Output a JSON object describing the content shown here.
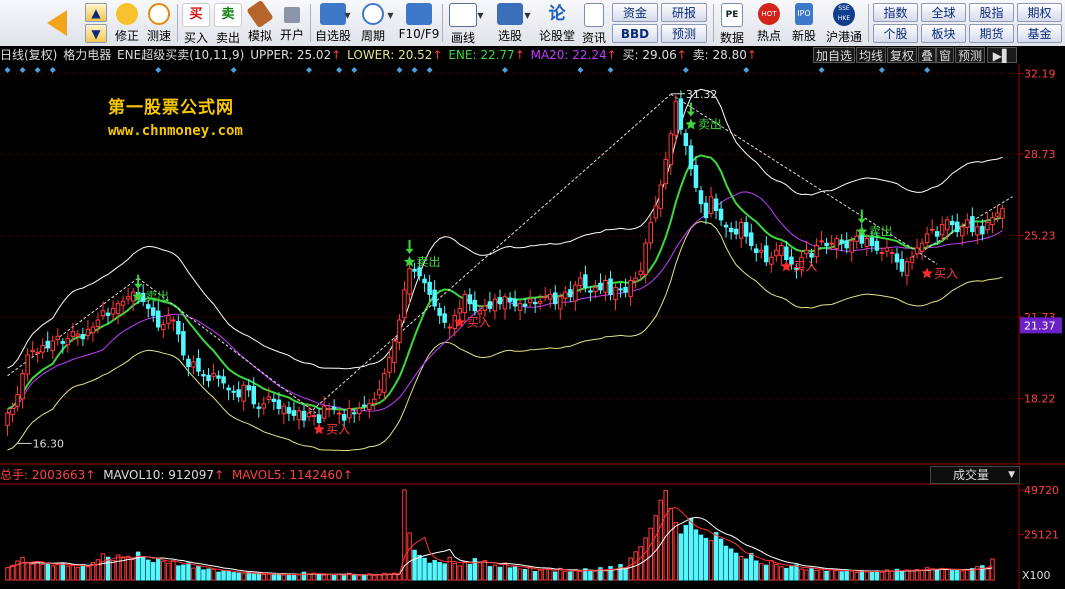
{
  "toolbar": {
    "nav": [
      {
        "label": "修正",
        "icon": "fix-icon"
      },
      {
        "label": "测速",
        "icon": "speed-clock-icon"
      }
    ],
    "trade": [
      {
        "label": "买入",
        "glyph": "买",
        "color": "#d01010"
      },
      {
        "label": "卖出",
        "glyph": "卖",
        "color": "#108010"
      },
      {
        "label": "模拟",
        "icon": "gavel-icon"
      },
      {
        "label": "开户",
        "icon": "lock-icon"
      }
    ],
    "tools": [
      {
        "label": "自选股",
        "icon": "watchlist-icon"
      },
      {
        "label": "周期",
        "icon": "period-icon"
      },
      {
        "label": "F10/F9",
        "icon": "f10-icon"
      },
      {
        "label": "画线",
        "icon": "draw-line-icon"
      },
      {
        "label": "选股",
        "icon": "stock-screen-icon"
      },
      {
        "label": "论股堂",
        "glyph": "论",
        "icon": "forum-icon"
      },
      {
        "label": "资讯",
        "icon": "news-icon"
      }
    ],
    "grid_left": {
      "top": [
        "资金",
        "研报"
      ],
      "bottom": [
        "BBD",
        "预测"
      ]
    },
    "data_buttons": [
      {
        "label": "数据",
        "badge": "PE",
        "icon": "data-pe-icon"
      },
      {
        "label": "热点",
        "badge": "HOT",
        "icon": "hot-icon"
      },
      {
        "label": "新股",
        "badge": "IPO",
        "icon": "ipo-icon"
      },
      {
        "label": "沪港通",
        "badge": "SSE HKE",
        "icon": "hk-connect-icon"
      }
    ],
    "grid_right": {
      "top": [
        "指数",
        "全球",
        "股指",
        "期权"
      ],
      "bottom": [
        "个股",
        "板块",
        "期货",
        "基金"
      ]
    }
  },
  "info_bar": {
    "period": "日线(复权)",
    "stock": "格力电器",
    "indicator": "ENE超级买卖(10,11,9)",
    "upper": "UPPER: 25.02",
    "lower": "LOWER: 20.52",
    "ene": "ENE: 22.77",
    "ma20": "MA20: 22.24",
    "buy": "买: 29.06",
    "sell": "卖: 28.80",
    "arrow": "↑",
    "buttons": [
      "加自选",
      "均线",
      "复权",
      "叠",
      "窗",
      "预测"
    ]
  },
  "watermark": {
    "title": "第一股票公式网",
    "url": "www.chnmoney.com"
  },
  "price_axis": {
    "ticks": [
      "32.19",
      "28.73",
      "25.23",
      "21.73",
      "18.22"
    ],
    "current": "21.37"
  },
  "volume_axis": {
    "ticks": [
      "49720",
      "25121"
    ],
    "unit": "X100"
  },
  "volume_header": {
    "total": "总手: 2003663",
    "mavol10": "MAVOL10: 912097",
    "mavol5": "MAVOL5: 1142460",
    "arrow": "↑",
    "selector": "成交量"
  },
  "colors": {
    "up": "#ff3b3b",
    "down": "#54f7ff",
    "ene": "#3ed63e",
    "ma20": "#c43cff",
    "upper": "#ffffff",
    "lower": "#e3e38a",
    "axis": "#a00000",
    "label": "#ff4040"
  },
  "chart_data": {
    "type": "candlestick",
    "y_range": [
      15.5,
      32.6
    ],
    "price_ticks": [
      32.19,
      28.73,
      25.23,
      21.73,
      18.22
    ],
    "annotations": [
      {
        "text": "16.30",
        "bar": 2,
        "price": 16.3
      },
      {
        "text": "31.32",
        "bar": 132,
        "price": 31.32
      }
    ],
    "signals": [
      {
        "type": "sell",
        "label": "卖出",
        "bar": 26,
        "price": 22.6
      },
      {
        "type": "buy",
        "label": "买入",
        "bar": 62,
        "price": 16.9
      },
      {
        "type": "sell",
        "label": "卖出",
        "bar": 80,
        "price": 24.1
      },
      {
        "type": "buy",
        "label": "买入",
        "bar": 90,
        "price": 21.5
      },
      {
        "type": "sell",
        "label": "卖出",
        "bar": 136,
        "price": 30.0
      },
      {
        "type": "buy",
        "label": "买入",
        "bar": 155,
        "price": 23.9
      },
      {
        "type": "sell",
        "label": "卖出",
        "bar": 170,
        "price": 25.4
      },
      {
        "type": "buy",
        "label": "买入",
        "bar": 183,
        "price": 23.6
      }
    ],
    "close": [
      17.6,
      17.8,
      18.4,
      19.3,
      20.1,
      20.3,
      20.2,
      20.5,
      20.4,
      20.7,
      20.9,
      20.6,
      20.8,
      21.1,
      21.0,
      20.8,
      21.2,
      21.3,
      21.6,
      22.0,
      21.8,
      22.1,
      22.3,
      22.4,
      22.6,
      22.8,
      22.6,
      22.4,
      22.1,
      21.8,
      21.3,
      21.4,
      21.8,
      21.6,
      21.0,
      20.1,
      19.6,
      19.8,
      19.4,
      19.2,
      19.0,
      19.3,
      19.1,
      18.9,
      18.6,
      18.5,
      18.3,
      18.8,
      18.6,
      18.0,
      17.8,
      18.0,
      18.3,
      18.1,
      17.8,
      17.9,
      17.6,
      17.5,
      17.7,
      17.3,
      17.6,
      17.5,
      17.2,
      17.9,
      17.8,
      17.8,
      17.6,
      17.3,
      17.8,
      17.6,
      17.8,
      17.9,
      18.0,
      18.2,
      18.6,
      19.3,
      20.0,
      20.7,
      21.6,
      22.9,
      23.8,
      23.7,
      23.5,
      23.2,
      22.7,
      22.2,
      21.8,
      21.5,
      21.3,
      21.8,
      22.1,
      22.7,
      22.3,
      22.0,
      22.0,
      22.2,
      22.1,
      22.5,
      22.3,
      22.6,
      22.4,
      22.2,
      22.3,
      22.2,
      22.5,
      22.3,
      22.4,
      22.6,
      22.7,
      22.3,
      22.6,
      22.8,
      22.6,
      23.1,
      23.4,
      23.0,
      22.8,
      23.0,
      22.9,
      23.3,
      22.7,
      23.0,
      22.9,
      22.8,
      23.3,
      23.4,
      23.7,
      24.9,
      25.8,
      26.5,
      27.4,
      28.5,
      29.6,
      31.0,
      29.8,
      29.1,
      28.1,
      27.3,
      26.6,
      26.0,
      26.9,
      26.3,
      25.9,
      25.6,
      25.4,
      25.3,
      25.8,
      25.2,
      24.8,
      24.5,
      24.6,
      24.1,
      24.3,
      24.6,
      24.8,
      24.2,
      24.0,
      23.8,
      24.3,
      24.6,
      24.3,
      24.8,
      25.0,
      24.8,
      24.9,
      25.1,
      24.9,
      24.7,
      25.0,
      25.2,
      24.9,
      25.1,
      24.8,
      24.6,
      24.5,
      24.7,
      24.5,
      24.1,
      23.7,
      24.1,
      24.3,
      24.7,
      24.9,
      25.3,
      25.5,
      25.2,
      25.7,
      25.9,
      25.7,
      25.4,
      25.6,
      25.9,
      25.4,
      25.6,
      25.3,
      25.8,
      26.0,
      26.2,
      26.4
    ],
    "volume": [
      6800,
      8200,
      10500,
      12400,
      9800,
      8800,
      10100,
      8600,
      9200,
      7900,
      8500,
      9100,
      7600,
      8000,
      7000,
      8400,
      7300,
      9600,
      11200,
      14500,
      12600,
      10800,
      13800,
      12200,
      13100,
      11200,
      15400,
      12900,
      11000,
      9600,
      11800,
      10400,
      9300,
      10700,
      7800,
      8300,
      9400,
      6600,
      7400,
      5600,
      6100,
      5900,
      4300,
      5000,
      4800,
      4100,
      3800,
      3400,
      4200,
      3600,
      3900,
      3100,
      3200,
      2900,
      3400,
      2700,
      3000,
      3200,
      2800,
      4300,
      3500,
      3800,
      3000,
      2700,
      3300,
      2500,
      3100,
      2600,
      3700,
      2800,
      2300,
      2900,
      3400,
      2600,
      3000,
      3700,
      3300,
      3800,
      3500,
      49720,
      26000,
      16400,
      13600,
      12000,
      9300,
      10800,
      9700,
      8900,
      12500,
      9200,
      7800,
      10000,
      8600,
      11800,
      9600,
      10700,
      7400,
      8200,
      7000,
      9400,
      6700,
      7700,
      6100,
      5800,
      7200,
      4700,
      5400,
      6600,
      5900,
      4400,
      6400,
      4800,
      4500,
      5700,
      4700,
      6200,
      5300,
      4800,
      6800,
      5100,
      7400,
      6100,
      8500,
      6700,
      12100,
      15600,
      18400,
      23200,
      28600,
      35500,
      44100,
      49400,
      39600,
      31700,
      25400,
      30100,
      33900,
      27700,
      24800,
      23000,
      21800,
      26200,
      22600,
      18700,
      17100,
      14800,
      13000,
      11600,
      14700,
      10500,
      9000,
      8200,
      10700,
      8600,
      7300,
      6400,
      7400,
      8300,
      6100,
      5500,
      6400,
      5300,
      6200,
      4800,
      5800,
      5200,
      4600,
      5700,
      4900,
      4200,
      5300,
      4500,
      4600,
      5100,
      4300,
      5600,
      4800,
      5900,
      4900,
      5600,
      5200,
      5800,
      5500,
      6800,
      6200,
      5900,
      6400,
      5800,
      5200,
      5600,
      4900,
      5600,
      6300,
      7400,
      7900,
      6700,
      11600
    ]
  }
}
